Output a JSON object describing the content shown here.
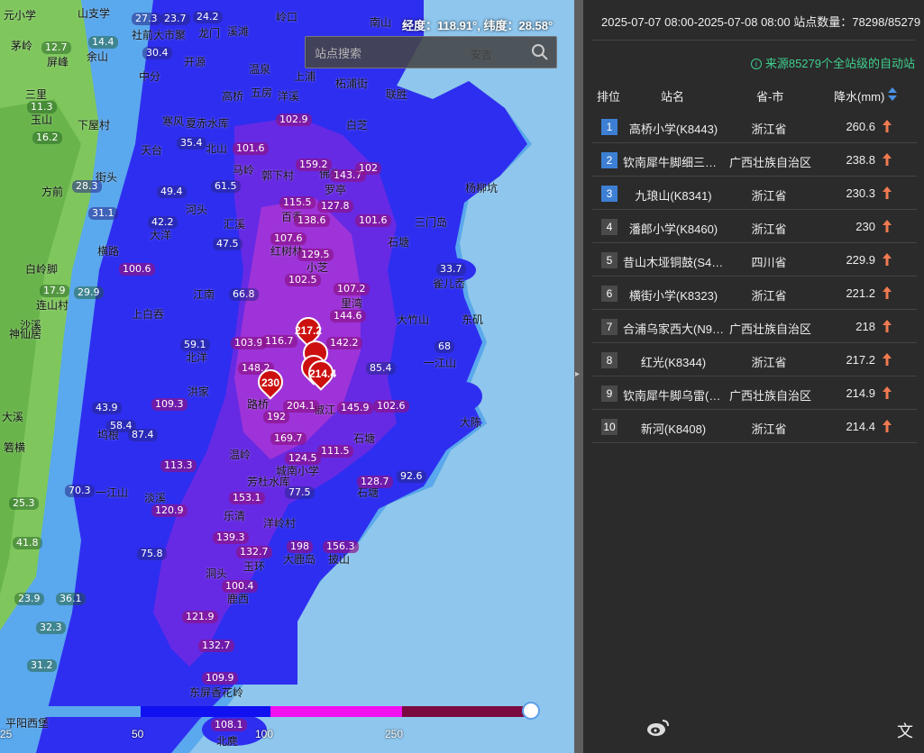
{
  "map": {
    "coord_label": "经度：118.91°, 纬度：28.58°",
    "search_placeholder": "站点搜索",
    "legend_ticks": [
      "25",
      "50",
      "100",
      "250"
    ],
    "places": [
      {
        "t": "元小学"
      },
      {
        "t": "山支学"
      },
      {
        "t": "龙门"
      },
      {
        "t": "岭口"
      },
      {
        "t": "南山"
      },
      {
        "t": "茅岭"
      },
      {
        "t": "社前大市聚"
      },
      {
        "t": "溪滩"
      },
      {
        "t": "开源"
      },
      {
        "t": "安吉"
      },
      {
        "t": "屏峰"
      },
      {
        "t": "余山"
      },
      {
        "t": "中分"
      },
      {
        "t": "上浦"
      },
      {
        "t": "柘浦街"
      },
      {
        "t": "联胜"
      },
      {
        "t": "温泉"
      },
      {
        "t": "高桥"
      },
      {
        "t": "洋溪"
      },
      {
        "t": "五房"
      },
      {
        "t": "三里"
      },
      {
        "t": "下屋村"
      },
      {
        "t": "寒风"
      },
      {
        "t": "夏赤水库"
      },
      {
        "t": "白芝"
      },
      {
        "t": "玉山"
      },
      {
        "t": "天台"
      },
      {
        "t": "北山"
      },
      {
        "t": "郭下村"
      },
      {
        "t": "马岭"
      },
      {
        "t": "罗亭"
      },
      {
        "t": "杨柳坑"
      },
      {
        "t": "佛头"
      },
      {
        "t": "方前"
      },
      {
        "t": "街头"
      },
      {
        "t": "三门岛"
      },
      {
        "t": "河头"
      },
      {
        "t": "汇溪"
      },
      {
        "t": "百香"
      },
      {
        "t": "大洋"
      },
      {
        "t": "横路"
      },
      {
        "t": "红树林"
      },
      {
        "t": "小芝"
      },
      {
        "t": "石塘"
      },
      {
        "t": "雀儿岙"
      },
      {
        "t": "白岭脚"
      },
      {
        "t": "江南"
      },
      {
        "t": "里湾"
      },
      {
        "t": "大竹山"
      },
      {
        "t": "东矶"
      },
      {
        "t": "连山村"
      },
      {
        "t": "上白吞"
      },
      {
        "t": "沙溪"
      },
      {
        "t": "神仙居"
      },
      {
        "t": "一江山"
      },
      {
        "t": "北洋"
      },
      {
        "t": "路桥"
      },
      {
        "t": "洪家"
      },
      {
        "t": "椒江"
      },
      {
        "t": "大陈"
      },
      {
        "t": "温岭"
      },
      {
        "t": "石塘"
      },
      {
        "t": "坞根"
      },
      {
        "t": "大溪"
      },
      {
        "t": "箬横"
      },
      {
        "t": "城南小学"
      },
      {
        "t": "芳杜水库"
      },
      {
        "t": "淡溪"
      },
      {
        "t": "乐清"
      },
      {
        "t": "玉环"
      },
      {
        "t": "大鹿岛"
      },
      {
        "t": "披山"
      },
      {
        "t": "洞头"
      },
      {
        "t": "鹿西"
      },
      {
        "t": "东屏香花岭"
      },
      {
        "t": "北麂"
      },
      {
        "t": "平阳西堡"
      },
      {
        "t": "一江山"
      },
      {
        "t": "洋岭村"
      },
      {
        "t": "石塘"
      }
    ],
    "values": [
      {
        "t": "27.3"
      },
      {
        "t": "23.7"
      },
      {
        "t": "24.2"
      },
      {
        "t": "12.7"
      },
      {
        "t": "14.4"
      },
      {
        "t": "30.4"
      },
      {
        "t": "11.3"
      },
      {
        "t": "16.2"
      },
      {
        "t": "35.4"
      },
      {
        "t": "28.3"
      },
      {
        "t": "31.1"
      },
      {
        "t": "49.4"
      },
      {
        "t": "42.2"
      },
      {
        "t": "47.5"
      },
      {
        "t": "61.5"
      },
      {
        "t": "33.7"
      },
      {
        "t": "66.8"
      },
      {
        "t": "17.9"
      },
      {
        "t": "29.9"
      },
      {
        "t": "59.1"
      },
      {
        "t": "85.4"
      },
      {
        "t": "68"
      },
      {
        "t": "43.9"
      },
      {
        "t": "58.4"
      },
      {
        "t": "87.4"
      },
      {
        "t": "75.8"
      },
      {
        "t": "77.5"
      },
      {
        "t": "92.6"
      },
      {
        "t": "36.1"
      },
      {
        "t": "32.3"
      },
      {
        "t": "31.2"
      },
      {
        "t": "23.9"
      },
      {
        "t": "25.3"
      },
      {
        "t": "41.8"
      },
      {
        "t": "70.3"
      }
    ],
    "values_magenta": [
      {
        "t": "102.9"
      },
      {
        "t": "101.6"
      },
      {
        "t": "159.2"
      },
      {
        "t": "143.7"
      },
      {
        "t": "102"
      },
      {
        "t": "115.5"
      },
      {
        "t": "127.8"
      },
      {
        "t": "138.6"
      },
      {
        "t": "101.6"
      },
      {
        "t": "107.6"
      },
      {
        "t": "129.5"
      },
      {
        "t": "102.5"
      },
      {
        "t": "107.2"
      },
      {
        "t": "144.6"
      },
      {
        "t": "103.9"
      },
      {
        "t": "116.7"
      },
      {
        "t": "142.2"
      },
      {
        "t": "148.2"
      },
      {
        "t": "204.1"
      },
      {
        "t": "192"
      },
      {
        "t": "169.7"
      },
      {
        "t": "124.5"
      },
      {
        "t": "111.5"
      },
      {
        "t": "145.9"
      },
      {
        "t": "102.6"
      },
      {
        "t": "128.7"
      },
      {
        "t": "113.3"
      },
      {
        "t": "120.9"
      },
      {
        "t": "153.1"
      },
      {
        "t": "139.3"
      },
      {
        "t": "132.7"
      },
      {
        "t": "198"
      },
      {
        "t": "156.3"
      },
      {
        "t": "100.4"
      },
      {
        "t": "121.9"
      },
      {
        "t": "132.7"
      },
      {
        "t": "109.9"
      },
      {
        "t": "108.1"
      },
      {
        "t": "100.6"
      },
      {
        "t": "109.3"
      }
    ],
    "pins": [
      {
        "t": "217.2"
      },
      {
        "t": "230"
      },
      {
        "t": "214.4"
      }
    ]
  },
  "panel": {
    "header": "2025-07-07 08:00-2025-07-08 08:00  站点数量：78298/85279",
    "source_note": "来源85279个全站级的自动站",
    "columns": {
      "rank": "排位",
      "station": "站名",
      "province": "省-市",
      "rain": "降水(mm)"
    },
    "rows": [
      {
        "rank": "1",
        "station": "高桥小学(K8443)",
        "province": "浙江省",
        "rain": "260.6"
      },
      {
        "rank": "2",
        "station": "钦南犀牛脚细三墩…",
        "province": "广西壮族自治区",
        "rain": "238.8"
      },
      {
        "rank": "3",
        "station": "九琅山(K8341)",
        "province": "浙江省",
        "rain": "230.3"
      },
      {
        "rank": "4",
        "station": "潘郎小学(K8460)",
        "province": "浙江省",
        "rain": "230"
      },
      {
        "rank": "5",
        "station": "昔山木垭铜鼓(S43…",
        "province": "四川省",
        "rain": "229.9"
      },
      {
        "rank": "6",
        "station": "横街小学(K8323)",
        "province": "浙江省",
        "rain": "221.2"
      },
      {
        "rank": "7",
        "station": "合浦乌家西大(N9…",
        "province": "广西壮族自治区",
        "rain": "218"
      },
      {
        "rank": "8",
        "station": "红光(K8344)",
        "province": "浙江省",
        "rain": "217.2"
      },
      {
        "rank": "9",
        "station": "钦南犀牛脚乌雷(N…",
        "province": "广西壮族自治区",
        "rain": "214.9"
      },
      {
        "rank": "10",
        "station": "新河(K8408)",
        "province": "浙江省",
        "rain": "214.4"
      }
    ],
    "corner_char": "文"
  },
  "colors": {
    "land_green": "#7fc75d",
    "rain_blue": "#2e2ef0",
    "rain_magenta": "#c23ad0",
    "sea": "#8ec6ee",
    "accent_green": "#3fcf8e",
    "rank_blue": "#3d7fd4",
    "up_arrow": "#f07a50"
  }
}
